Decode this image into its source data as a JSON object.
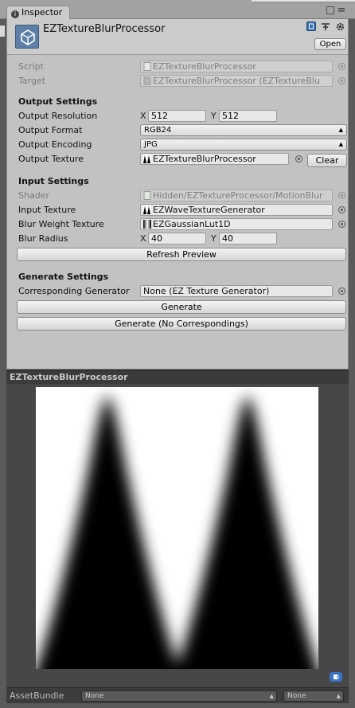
{
  "window": {
    "tab_label": "Inspector",
    "tab_icon": "info-icon"
  },
  "header": {
    "object_title": "EZTextureBlurProcessor",
    "open_label": "Open",
    "icons": [
      "help-book-icon",
      "layout-icon",
      "gear-icon"
    ]
  },
  "fields": {
    "script": {
      "label": "Script",
      "value": "EZTextureBlurProcessor"
    },
    "target": {
      "label": "Target",
      "value": "EZTextureBlurProcessor (EZTextureBlu"
    }
  },
  "output_settings": {
    "heading": "Output Settings",
    "resolution": {
      "label": "Output Resolution",
      "x_label": "X",
      "x": "512",
      "y_label": "Y",
      "y": "512"
    },
    "format": {
      "label": "Output Format",
      "value": "RGB24"
    },
    "encoding": {
      "label": "Output Encoding",
      "value": "JPG"
    },
    "texture": {
      "label": "Output Texture",
      "value": "EZTextureBlurProcessor",
      "clear_label": "Clear"
    }
  },
  "input_settings": {
    "heading": "Input Settings",
    "shader": {
      "label": "Shader",
      "value": "Hidden/EZTextureProcessor/MotionBlur"
    },
    "input_texture": {
      "label": "Input Texture",
      "value": "EZWaveTextureGenerator"
    },
    "blur_weight": {
      "label": "Blur Weight Texture",
      "value": "EZGaussianLut1D"
    },
    "blur_radius": {
      "label": "Blur Radius",
      "x_label": "X",
      "x": "40",
      "y_label": "Y",
      "y": "40"
    },
    "refresh_label": "Refresh Preview"
  },
  "generate_settings": {
    "heading": "Generate Settings",
    "generator": {
      "label": "Corresponding Generator",
      "value": "None (EZ Texture Generator)"
    },
    "generate_label": "Generate",
    "generate_no_corr_label": "Generate (No Correspondings)"
  },
  "preview": {
    "title": "EZTextureBlurProcessor",
    "image": "blurred-double-peak-texture"
  },
  "asset_bundle": {
    "label": "AssetBundle",
    "name_value": "None",
    "variant_value": "None"
  },
  "colors": {
    "panel": "#c2c2c2",
    "header": "#cbcbcb",
    "preview_bg": "#474747",
    "accent": "#3873c4"
  }
}
